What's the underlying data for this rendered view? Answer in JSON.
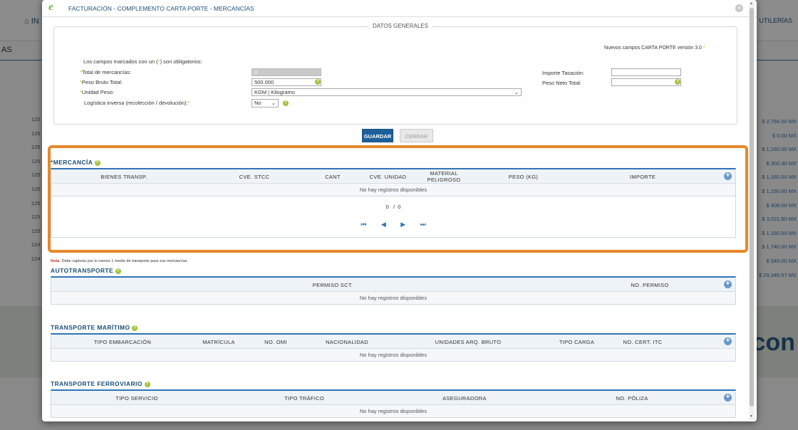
{
  "background": {
    "home_label": "IN",
    "util_label": "UTILERÍAS",
    "section_label": "AS",
    "left_ids": [
      "125",
      "125",
      "125",
      "125",
      "125",
      "125",
      "125",
      "125",
      "125",
      "124",
      "124"
    ],
    "amounts": [
      "$ 2,784.00 MX",
      "$ 0.00 MX",
      "$ 1,160.00 MX",
      "$ 302.40 MX",
      "$ 1,160.00 MX",
      "$ 1,160.00 MX",
      "$ 406.00 MX",
      "$ 3,021.80 MX",
      "$ 1,160.00 MX",
      "$ 1,740.00 MX",
      "$ 540.00 MX",
      "$ 29,348.57 MX"
    ],
    "logo": "con"
  },
  "modal": {
    "logo": "e",
    "title": "FACTURACIÓN - COMPLEMENTO CARTA PORTE - MERCANCÍAS",
    "close": "✕"
  },
  "general": {
    "legend": "DATOS GENERALES",
    "version_note": "Nuevos campos CARTA PORTE versión 3.0",
    "version_star": "*",
    "required_note_pre": "Los campos marcados con un (",
    "required_note_star": "*",
    "required_note_post": ") son obligatorios:",
    "star": "*",
    "total_label": "Total de mercancías:",
    "total_value": "0",
    "peso_bruto_label": "Peso Bruto Total:",
    "peso_bruto_value": "500.000",
    "unidad_label": "Unidad Peso:",
    "unidad_value": "KGM | Kilogramo",
    "logistica_label": "Logística inversa (recolección / devolución):",
    "logistica_value": "No",
    "importe_label": "Importe Tasación:",
    "importe_value": "",
    "peso_neto_label": "Peso Neto Total:",
    "peso_neto_value": "",
    "help": "?"
  },
  "buttons": {
    "save": "GUARDAR",
    "close": "CERRAR"
  },
  "mercancia": {
    "title": "*MERCANCÍA",
    "columns": [
      "BIENES TRANSP.",
      "CVE. STCC",
      "CANT",
      "CVE. UNIDAD",
      "MATERIAL PELIGROSO",
      "PESO (KG)",
      "IMPORTE"
    ],
    "empty": "No hay registros disponibles",
    "pager_count": "0   /  0",
    "pager_first": "⏮",
    "pager_prev": "◀",
    "pager_next": "▶",
    "pager_last": "⏭"
  },
  "nota": {
    "label": "Nota:",
    "text": " Debe capturar por lo menos 1 medio de transporte para sus mercancías."
  },
  "autotransporte": {
    "title": "AUTOTRANSPORTE",
    "columns": [
      "PERMISO SCT.",
      "NO. PERMISO"
    ],
    "empty": "No hay registros disponibles"
  },
  "maritimo": {
    "title": "TRANSPORTE MARÍTIMO",
    "columns": [
      "TIPO EMBARCACIÓN",
      "MATRÍCULA",
      "NO. OMI",
      "NACIONALIDAD",
      "UNIDADES ARQ. BRUTO",
      "TIPO CARGA",
      "NO. CERT. ITC"
    ],
    "empty": "No hay registros disponibles"
  },
  "ferroviario": {
    "title": "TRANSPORTE FERROVIARIO",
    "columns": [
      "TIPO SERVICIO",
      "TIPO TRÁFICO",
      "ASEGURADORA",
      "NO. PÓLIZA"
    ],
    "empty": "No hay registros disponibles"
  },
  "add_icon": "+",
  "colors": {
    "accent": "#2f75b5",
    "highlight": "#e8872a",
    "help": "#a0c23b"
  }
}
